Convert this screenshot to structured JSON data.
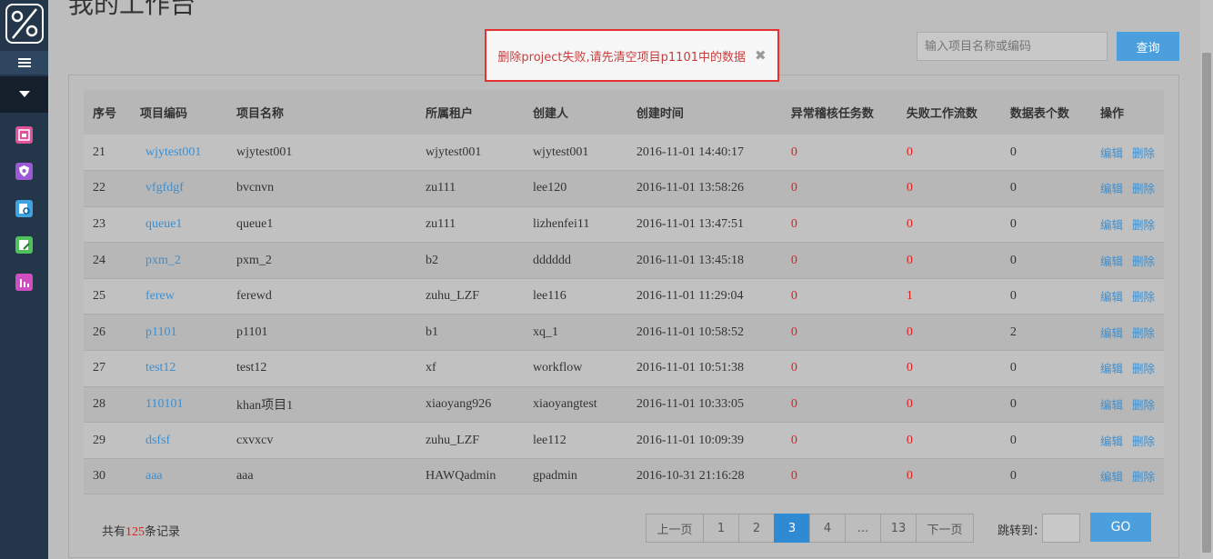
{
  "page": {
    "title": "我的工作台"
  },
  "sidebar": {
    "icons": [
      {
        "name": "logo-icon",
        "color": "#ffffff"
      },
      {
        "name": "menu-icon",
        "color": "#ffffff"
      },
      {
        "name": "chevron-down-icon",
        "color": "#ffffff"
      },
      {
        "name": "calendar-icon",
        "color": "#e0529a"
      },
      {
        "name": "shield-icon",
        "color": "#9b59d6"
      },
      {
        "name": "search-doc-icon",
        "color": "#3ea3e0"
      },
      {
        "name": "edit-doc-icon",
        "color": "#4fc15a"
      },
      {
        "name": "bar-chart-icon",
        "color": "#d04fc0"
      }
    ]
  },
  "search": {
    "placeholder": "输入项目名称或编码",
    "button_label": "查询"
  },
  "toast": {
    "message": "删除project失败,请先清空项目p1101中的数据",
    "close_glyph": "✖"
  },
  "table": {
    "headers": [
      "序号",
      "项目编码",
      "项目名称",
      "所属租户",
      "创建人",
      "创建时间",
      "异常稽核任务数",
      "失败工作流数",
      "数据表个数",
      "操作"
    ],
    "rows": [
      [
        "21",
        "wjytest001",
        "wjytest001",
        "wjytest001",
        "wjytest001",
        "2016-11-01 14:40:17",
        "0",
        "0",
        "0"
      ],
      [
        "22",
        "vfgfdgf",
        "bvcnvn",
        "zu111",
        "lee120",
        "2016-11-01 13:58:26",
        "0",
        "0",
        "0"
      ],
      [
        "23",
        "queue1",
        "queue1",
        "zu111",
        "lizhenfei11",
        "2016-11-01 13:47:51",
        "0",
        "0",
        "0"
      ],
      [
        "24",
        "pxm_2",
        "pxm_2",
        "b2",
        "dddddd",
        "2016-11-01 13:45:18",
        "0",
        "0",
        "0"
      ],
      [
        "25",
        "ferew",
        "ferewd",
        "zuhu_LZF",
        "lee116",
        "2016-11-01 11:29:04",
        "0",
        "1",
        "0"
      ],
      [
        "26",
        "p1101",
        "p1101",
        "b1",
        "xq_1",
        "2016-11-01 10:58:52",
        "0",
        "0",
        "2"
      ],
      [
        "27",
        "test12",
        "test12",
        "xf",
        "workflow",
        "2016-11-01 10:51:38",
        "0",
        "0",
        "0"
      ],
      [
        "28",
        "110101",
        "khan项目1",
        "xiaoyang926",
        "xiaoyangtest",
        "2016-11-01 10:33:05",
        "0",
        "0",
        "0"
      ],
      [
        "29",
        "dsfsf",
        "cxvxcv",
        "zuhu_LZF",
        "lee112",
        "2016-11-01 10:09:39",
        "0",
        "0",
        "0"
      ],
      [
        "30",
        "aaa",
        "aaa",
        "HAWQadmin",
        "gpadmin",
        "2016-10-31 21:16:28",
        "0",
        "0",
        "0"
      ]
    ],
    "actions": {
      "edit": "编辑",
      "delete": "删除"
    }
  },
  "footer": {
    "prefix": "共有",
    "count": "125",
    "suffix": "条记录",
    "pages": [
      "上一页",
      "1",
      "2",
      "3",
      "4",
      "...",
      "13",
      "下一页"
    ],
    "active_page": "3",
    "jump_label": "跳转到：",
    "go_label": "GO"
  },
  "colors": {
    "accent": "#4a9fdc",
    "danger": "#e21d1d",
    "sidebar": "#23364a"
  }
}
